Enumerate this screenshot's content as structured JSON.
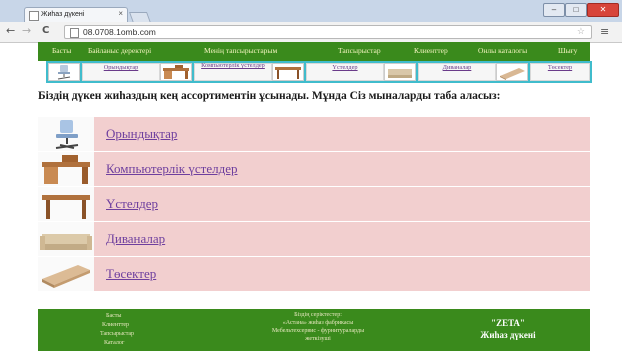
{
  "browser": {
    "tab_title": "Жиһаз дүкені",
    "tab_close": "×",
    "url": "08.0708.1omb.com",
    "back": "←",
    "forward": "→",
    "reload": "C",
    "star": "☆",
    "menu": "≡",
    "minimize": "–",
    "maximize": "□",
    "close": "✕"
  },
  "nav": {
    "items": [
      "Басты",
      "Байланыс деректері",
      "Менің тапсырыстарым",
      "Тапсырыстар",
      "Клиенттер",
      "Онлы каталогы",
      "Шығу"
    ]
  },
  "categories": {
    "items": [
      "Орындықтар",
      "Компьютерлік үстелдер",
      "Үстелдер",
      "Диваналар",
      "Төсектер"
    ]
  },
  "main": {
    "heading": "Біздің дүкен жиһаздың кең ассортиментін ұсынады. Мұнда Сіз мыналарды таба аласыз:",
    "list": [
      {
        "label": "Орындықтар",
        "icon": "chair-icon"
      },
      {
        "label": "Компьютерлік үстелдер",
        "icon": "computer-desk-icon"
      },
      {
        "label": "Үстелдер",
        "icon": "table-icon"
      },
      {
        "label": "Диваналар",
        "icon": "sofa-icon"
      },
      {
        "label": "Төсектер",
        "icon": "bed-icon"
      }
    ]
  },
  "footer": {
    "links": [
      "Басты",
      "Клиенттер",
      "Тапсырыстар",
      "Каталог"
    ],
    "partners_title": "Біздің серіктестер:",
    "partners": [
      "«Астана» жиһаз фабрикасы",
      "Мебельтехсервис - фурнитураларды",
      "жеткізуші"
    ],
    "brand_name": "\"ZETA\"",
    "brand_sub": "Жиһаз дүкені"
  },
  "colors": {
    "nav_bg": "#3a8a1c",
    "cat_bg": "#40bccc",
    "row_bg": "#f2cfcf",
    "link": "#6e3f9e"
  }
}
